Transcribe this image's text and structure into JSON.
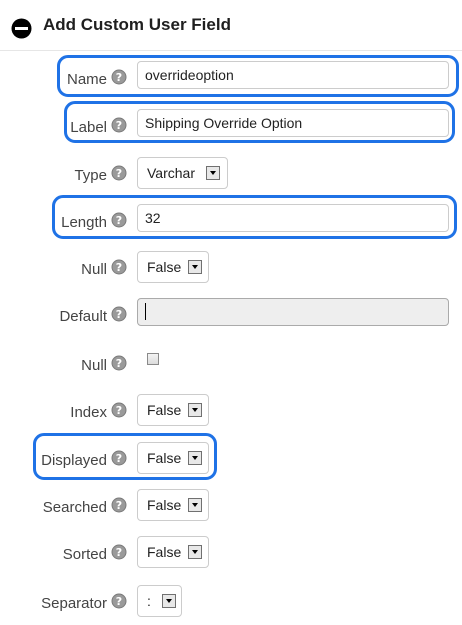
{
  "header": {
    "title": "Add Custom User Field",
    "collapse_icon": "collapse-icon"
  },
  "fields": {
    "name": {
      "label": "Name",
      "value": "overrideoption"
    },
    "label": {
      "label": "Label",
      "value": "Shipping Override Option"
    },
    "type": {
      "label": "Type",
      "value": "Varchar"
    },
    "length": {
      "label": "Length",
      "value": "32"
    },
    "null_select": {
      "label": "Null",
      "value": "False"
    },
    "default": {
      "label": "Default",
      "value": ""
    },
    "null_checkbox": {
      "label": "Null",
      "checked": false
    },
    "index": {
      "label": "Index",
      "value": "False"
    },
    "displayed": {
      "label": "Displayed",
      "value": "False"
    },
    "searched": {
      "label": "Searched",
      "value": "False"
    },
    "sorted": {
      "label": "Sorted",
      "value": "False"
    },
    "separator": {
      "label": "Separator",
      "value": ":"
    }
  },
  "help_icon": "help-icon",
  "highlight_color": "#1f72e6"
}
